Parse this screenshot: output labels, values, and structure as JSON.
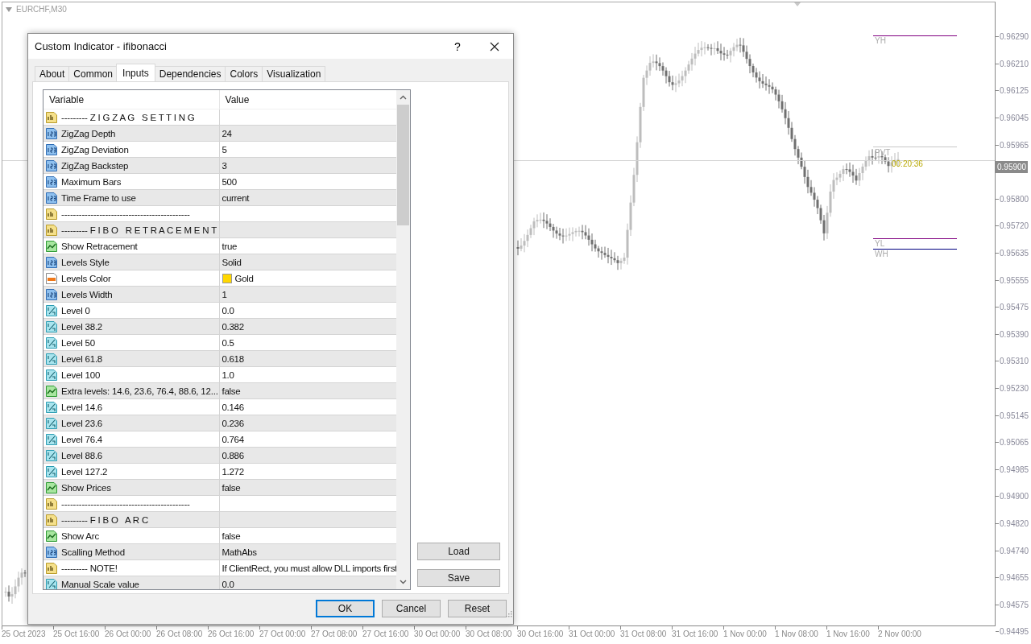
{
  "chart": {
    "symbol": "EURCHF,M30",
    "lines": [
      {
        "label": "YH",
        "color": "#800080"
      },
      {
        "label": "PVT",
        "color": "#c8c8c8"
      },
      {
        "label": "YL",
        "color": "#800080"
      },
      {
        "label": "WH",
        "color": "#000080"
      }
    ],
    "timer": "00:20:36",
    "price_axis": [
      {
        "text": "0.96290",
        "kind": "tick"
      },
      {
        "text": "0.96210",
        "kind": "tick"
      },
      {
        "text": "0.96125",
        "kind": "tick"
      },
      {
        "text": "0.96045",
        "kind": "tick"
      },
      {
        "text": "0.95965",
        "kind": "tick"
      },
      {
        "text": "0.95900",
        "kind": "current"
      },
      {
        "text": "0.95800",
        "kind": "tick"
      },
      {
        "text": "0.95720",
        "kind": "tick"
      },
      {
        "text": "0.95635",
        "kind": "tick"
      },
      {
        "text": "0.95555",
        "kind": "tick"
      },
      {
        "text": "0.95475",
        "kind": "tick"
      },
      {
        "text": "0.95390",
        "kind": "tick"
      },
      {
        "text": "0.95310",
        "kind": "tick"
      },
      {
        "text": "0.95230",
        "kind": "tick"
      },
      {
        "text": "0.95145",
        "kind": "tick"
      },
      {
        "text": "0.95065",
        "kind": "tick"
      },
      {
        "text": "0.94985",
        "kind": "tick"
      },
      {
        "text": "0.94900",
        "kind": "tick"
      },
      {
        "text": "0.94820",
        "kind": "tick"
      },
      {
        "text": "0.94740",
        "kind": "tick"
      },
      {
        "text": "0.94655",
        "kind": "tick"
      },
      {
        "text": "0.94575",
        "kind": "tick"
      },
      {
        "text": "0.94495",
        "kind": "tick"
      }
    ],
    "time_axis": [
      "25 Oct 2023",
      "25 Oct 16:00",
      "26 Oct 00:00",
      "26 Oct 08:00",
      "26 Oct 16:00",
      "27 Oct 00:00",
      "27 Oct 08:00",
      "27 Oct 16:00",
      "30 Oct 00:00",
      "30 Oct 08:00",
      "30 Oct 16:00",
      "31 Oct 00:00",
      "31 Oct 08:00",
      "31 Oct 16:00",
      "1 Nov 00:00",
      "1 Nov 08:00",
      "1 Nov 16:00",
      "2 Nov 00:00"
    ]
  },
  "dialog": {
    "title": "Custom Indicator - ifibonacci",
    "help": "?",
    "tabs": [
      {
        "label": "About",
        "selected": false
      },
      {
        "label": "Common",
        "selected": false
      },
      {
        "label": "Inputs",
        "selected": true
      },
      {
        "label": "Dependencies",
        "selected": false
      },
      {
        "label": "Colors",
        "selected": false
      },
      {
        "label": "Visualization",
        "selected": false
      }
    ],
    "table": {
      "columns": [
        "Variable",
        "Value"
      ],
      "rows": [
        {
          "kind": "string",
          "variable": "--------- Z I G Z A G   S E T T I N G",
          "value": ""
        },
        {
          "kind": "int",
          "variable": "ZigZag Depth",
          "value": "24"
        },
        {
          "kind": "int",
          "variable": "ZigZag Deviation",
          "value": "5"
        },
        {
          "kind": "int",
          "variable": "ZigZag Backstep",
          "value": "3"
        },
        {
          "kind": "int",
          "variable": "Maximum Bars",
          "value": "500"
        },
        {
          "kind": "int",
          "variable": "Time Frame to use",
          "value": "current"
        },
        {
          "kind": "string",
          "variable": "--------------------------------------------",
          "value": ""
        },
        {
          "kind": "string",
          "variable": "--------- F I B O   R E T R A C E M E N T",
          "value": ""
        },
        {
          "kind": "bool",
          "variable": "Show Retracement",
          "value": "true"
        },
        {
          "kind": "int",
          "variable": "Levels Style",
          "value": "Solid"
        },
        {
          "kind": "color",
          "variable": "Levels Color",
          "value": "Gold",
          "color": "#ffd700"
        },
        {
          "kind": "int",
          "variable": "Levels Width",
          "value": "1"
        },
        {
          "kind": "double",
          "variable": "Level 0",
          "value": "0.0"
        },
        {
          "kind": "double",
          "variable": "Level 38.2",
          "value": "0.382"
        },
        {
          "kind": "double",
          "variable": "Level 50",
          "value": "0.5"
        },
        {
          "kind": "double",
          "variable": "Level 61.8",
          "value": "0.618"
        },
        {
          "kind": "double",
          "variable": "Level 100",
          "value": "1.0"
        },
        {
          "kind": "bool",
          "variable": "Extra levels: 14.6, 23.6, 76.4, 88.6, 12...",
          "value": "false"
        },
        {
          "kind": "double",
          "variable": "Level 14.6",
          "value": "0.146"
        },
        {
          "kind": "double",
          "variable": "Level 23.6",
          "value": "0.236"
        },
        {
          "kind": "double",
          "variable": "Level 76.4",
          "value": "0.764"
        },
        {
          "kind": "double",
          "variable": "Level 88.6",
          "value": "0.886"
        },
        {
          "kind": "double",
          "variable": "Level 127.2",
          "value": "1.272"
        },
        {
          "kind": "bool",
          "variable": "Show Prices",
          "value": "false"
        },
        {
          "kind": "string",
          "variable": "--------------------------------------------",
          "value": ""
        },
        {
          "kind": "string",
          "variable": "--------- F I B O   A R C",
          "value": ""
        },
        {
          "kind": "bool",
          "variable": "Show Arc",
          "value": "false"
        },
        {
          "kind": "int",
          "variable": "Scalling Method",
          "value": "MathAbs"
        },
        {
          "kind": "string",
          "variable": "--------- NOTE!",
          "value": "If ClientRect, you must allow DLL imports first"
        },
        {
          "kind": "double",
          "variable": "Manual Scale value",
          "value": "0.0"
        }
      ]
    },
    "side_buttons": [
      "Load",
      "Save"
    ],
    "buttons": [
      {
        "label": "OK",
        "default": true
      },
      {
        "label": "Cancel",
        "default": false
      },
      {
        "label": "Reset",
        "default": false
      }
    ]
  }
}
